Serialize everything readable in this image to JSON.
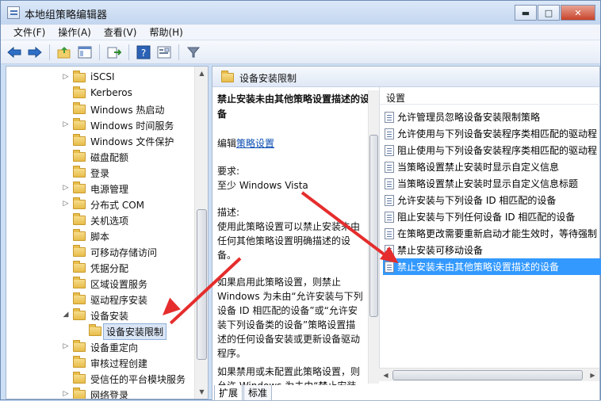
{
  "window": {
    "title": "本地组策略编辑器",
    "minimize": "▬",
    "maximize": "□",
    "close": "✕"
  },
  "menu": [
    "文件(F)",
    "操作(A)",
    "查看(V)",
    "帮助(H)"
  ],
  "toolbar": {
    "back_icon": "arrow-left-icon",
    "forward_icon": "arrow-right-icon",
    "up_icon": "folder-up-icon",
    "show_hide_icon": "console-tree-icon",
    "export_icon": "export-list-icon",
    "help_icon": "help-icon",
    "properties_icon": "properties-icon",
    "filter_icon": "filter-icon"
  },
  "tree": {
    "items": [
      {
        "label": "iSCSI",
        "expander": "▷"
      },
      {
        "label": "Kerberos",
        "expander": ""
      },
      {
        "label": "Windows 热启动",
        "expander": ""
      },
      {
        "label": "Windows 时间服务",
        "expander": "▷"
      },
      {
        "label": "Windows 文件保护",
        "expander": ""
      },
      {
        "label": "磁盘配额",
        "expander": ""
      },
      {
        "label": "登录",
        "expander": ""
      },
      {
        "label": "电源管理",
        "expander": "▷"
      },
      {
        "label": "分布式 COM",
        "expander": "▷"
      },
      {
        "label": "关机选项",
        "expander": ""
      },
      {
        "label": "脚本",
        "expander": ""
      },
      {
        "label": "可移动存储访问",
        "expander": ""
      },
      {
        "label": "凭据分配",
        "expander": ""
      },
      {
        "label": "区域设置服务",
        "expander": ""
      },
      {
        "label": "驱动程序安装",
        "expander": ""
      },
      {
        "label": "设备安装",
        "expander": "◢"
      },
      {
        "label": "设备安装限制",
        "expander": "",
        "selected": true
      },
      {
        "label": "设备重定向",
        "expander": "▷"
      },
      {
        "label": "审核过程创建",
        "expander": ""
      },
      {
        "label": "受信任的平台模块服务",
        "expander": ""
      },
      {
        "label": "网络登录",
        "expander": "▷"
      }
    ]
  },
  "right": {
    "header": "设备安装限制",
    "desc": {
      "title": "禁止安装未由其他策略设置描述的设备",
      "edit_prefix": "编辑",
      "edit_link": "策略设置",
      "req_label": "要求:",
      "req_value": "至少 Windows Vista",
      "desc_label": "描述:",
      "para1": "使用此策略设置可以禁止安装未由任何其他策略设置明确描述的设备。",
      "para2": "如果启用此策略设置，则禁止 Windows 为未由“允许安装与下列设备 ID 相匹配的设备”或“允许安装下列设备类的设备”策略设置描述的任何设备安装或更新设备驱动程序。",
      "para3": "如果禁用或未配置此策略设置，则允许 Windows 为未由“禁止安装"
    },
    "list_header": "设置",
    "settings": [
      "允许管理员忽略设备安装限制策略",
      "允许使用与下列设备安装程序类相匹配的驱动程",
      "阻止使用与下列设备安装程序类相匹配的驱动程",
      "当策略设置禁止安装时显示自定义信息",
      "当策略设置禁止安装时显示自定义信息标题",
      "允许安装与下列设备 ID 相匹配的设备",
      "阻止安装与下列任何设备 ID 相匹配的设备",
      "在策略更改需要重新启动才能生效时，等待强制",
      "禁止安装可移动设备",
      "禁止安装未由其他策略设置描述的设备"
    ],
    "selected_index": 9,
    "tabs": [
      "扩展",
      "标准"
    ]
  }
}
